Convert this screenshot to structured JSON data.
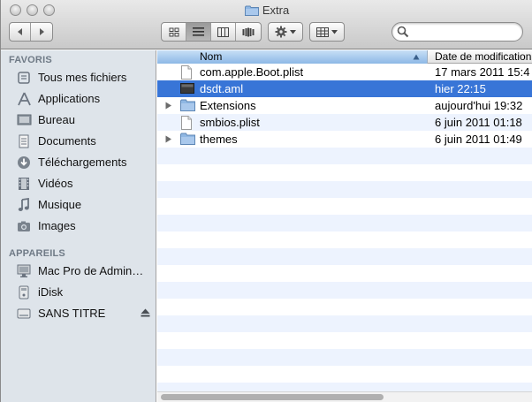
{
  "window": {
    "title": "Extra"
  },
  "toolbar": {
    "search": {
      "placeholder": "",
      "value": ""
    }
  },
  "sidebar": {
    "favoris_label": "FAVORIS",
    "favoris": [
      {
        "label": "Tous mes fichiers",
        "icon": "all-files-icon"
      },
      {
        "label": "Applications",
        "icon": "applications-icon"
      },
      {
        "label": "Bureau",
        "icon": "desktop-icon"
      },
      {
        "label": "Documents",
        "icon": "documents-icon"
      },
      {
        "label": "Téléchargements",
        "icon": "downloads-icon"
      },
      {
        "label": "Vidéos",
        "icon": "movies-icon"
      },
      {
        "label": "Musique",
        "icon": "music-icon"
      },
      {
        "label": "Images",
        "icon": "pictures-icon"
      }
    ],
    "appareils_label": "APPAREILS",
    "appareils": [
      {
        "label": "Mac Pro de Admin…",
        "icon": "computer-icon"
      },
      {
        "label": "iDisk",
        "icon": "idisk-icon"
      },
      {
        "label": "SANS TITRE",
        "icon": "drive-icon"
      }
    ]
  },
  "columns": {
    "name": "Nom",
    "date": "Date de modification"
  },
  "files": [
    {
      "name": "com.apple.Boot.plist",
      "date": "17 mars 2011 15:4",
      "kind": "file",
      "selected": false
    },
    {
      "name": "dsdt.aml",
      "date": "hier 22:15",
      "kind": "binary",
      "selected": true
    },
    {
      "name": "Extensions",
      "date": "aujourd'hui 19:32",
      "kind": "folder",
      "selected": false
    },
    {
      "name": "smbios.plist",
      "date": "6 juin 2011 01:18",
      "kind": "file",
      "selected": false
    },
    {
      "name": "themes",
      "date": "6 juin 2011 01:49",
      "kind": "folder",
      "selected": false
    }
  ],
  "colors": {
    "selection": "#3875d7",
    "sidebar": "#dee4ea",
    "header_active": "#8db8e6"
  }
}
